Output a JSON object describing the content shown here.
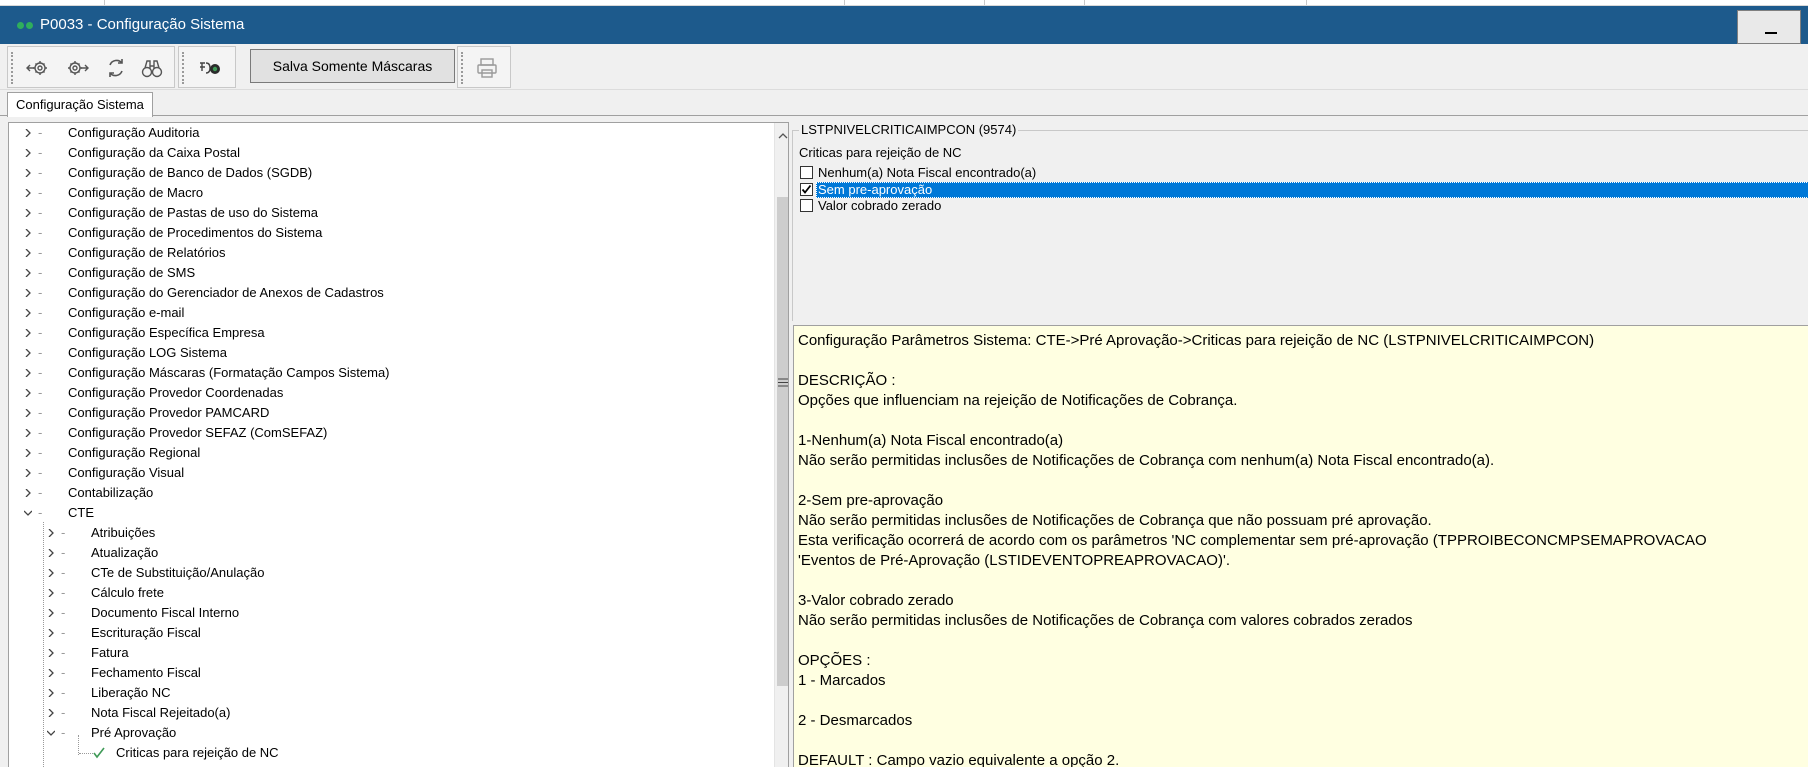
{
  "window": {
    "title": "P0033 - Configuração Sistema"
  },
  "toolbar": {
    "icons": [
      "gear-arrow-left-icon",
      "gear-arrow-right-icon",
      "refresh-icon",
      "binoculars-icon",
      "key-search-icon",
      "printer-icon"
    ],
    "save_masks_label": "Salva Somente Máscaras"
  },
  "tabs": [
    {
      "label": "Configuração Sistema",
      "active": true
    }
  ],
  "tree": {
    "items": [
      {
        "label": "Configuração Auditoria",
        "level": 0,
        "state": "collapsed"
      },
      {
        "label": "Configuração da Caixa Postal",
        "level": 0,
        "state": "collapsed"
      },
      {
        "label": "Configuração de Banco de Dados (SGDB)",
        "level": 0,
        "state": "collapsed"
      },
      {
        "label": "Configuração de Macro",
        "level": 0,
        "state": "collapsed"
      },
      {
        "label": "Configuração de Pastas de uso do Sistema",
        "level": 0,
        "state": "collapsed"
      },
      {
        "label": "Configuração de Procedimentos do Sistema",
        "level": 0,
        "state": "collapsed"
      },
      {
        "label": "Configuração de Relatórios",
        "level": 0,
        "state": "collapsed"
      },
      {
        "label": "Configuração de SMS",
        "level": 0,
        "state": "collapsed"
      },
      {
        "label": "Configuração do Gerenciador de Anexos de Cadastros",
        "level": 0,
        "state": "collapsed"
      },
      {
        "label": "Configuração e-mail",
        "level": 0,
        "state": "collapsed"
      },
      {
        "label": "Configuração Específica Empresa",
        "level": 0,
        "state": "collapsed"
      },
      {
        "label": "Configuração LOG Sistema",
        "level": 0,
        "state": "collapsed"
      },
      {
        "label": "Configuração Máscaras (Formatação Campos Sistema)",
        "level": 0,
        "state": "collapsed"
      },
      {
        "label": "Configuração Provedor Coordenadas",
        "level": 0,
        "state": "collapsed"
      },
      {
        "label": "Configuração Provedor PAMCARD",
        "level": 0,
        "state": "collapsed"
      },
      {
        "label": "Configuração Provedor SEFAZ (ComSEFAZ)",
        "level": 0,
        "state": "collapsed"
      },
      {
        "label": "Configuração Regional",
        "level": 0,
        "state": "collapsed"
      },
      {
        "label": "Configuração Visual",
        "level": 0,
        "state": "collapsed"
      },
      {
        "label": "Contabilização",
        "level": 0,
        "state": "collapsed"
      },
      {
        "label": "CTE",
        "level": 0,
        "state": "expanded"
      },
      {
        "label": "Atribuições",
        "level": 1,
        "state": "collapsed"
      },
      {
        "label": "Atualização",
        "level": 1,
        "state": "collapsed"
      },
      {
        "label": "CTe de Substituição/Anulação",
        "level": 1,
        "state": "collapsed"
      },
      {
        "label": "Cálculo frete",
        "level": 1,
        "state": "collapsed"
      },
      {
        "label": "Documento Fiscal Interno",
        "level": 1,
        "state": "collapsed"
      },
      {
        "label": "Escrituração Fiscal",
        "level": 1,
        "state": "collapsed"
      },
      {
        "label": "Fatura",
        "level": 1,
        "state": "collapsed"
      },
      {
        "label": "Fechamento Fiscal",
        "level": 1,
        "state": "collapsed"
      },
      {
        "label": "Liberação NC",
        "level": 1,
        "state": "collapsed"
      },
      {
        "label": "Nota Fiscal Rejeitado(a)",
        "level": 1,
        "state": "collapsed"
      },
      {
        "label": "Pré Aprovação",
        "level": 1,
        "state": "expanded"
      },
      {
        "label": "Criticas para rejeição de NC",
        "level": 2,
        "state": "leaf-checked"
      }
    ]
  },
  "parameter": {
    "legend": "LSTPNIVELCRITICAIMPCON (9574)",
    "caption": "Criticas para rejeição de NC",
    "options": [
      {
        "label": "Nenhum(a) Nota Fiscal encontrado(a)",
        "checked": false,
        "selected": false
      },
      {
        "label": "Sem pre-aprovação",
        "checked": true,
        "selected": true
      },
      {
        "label": "Valor cobrado zerado",
        "checked": false,
        "selected": false
      }
    ]
  },
  "description": {
    "lines": [
      "Configuração Parâmetros Sistema: CTE->Pré Aprovação->Criticas para rejeição de NC (LSTPNIVELCRITICAIMPCON)",
      "",
      "DESCRIÇÃO :",
      "Opções que influenciam na rejeição de Notificações de Cobrança.",
      "",
      "1-Nenhum(a) Nota Fiscal encontrado(a)",
      "Não serão permitidas inclusões de Notificações de Cobrança com nenhum(a) Nota Fiscal encontrado(a).",
      "",
      "2-Sem pre-aprovação",
      "Não serão permitidas inclusões de Notificações de Cobrança que não possuam pré aprovação.",
      "Esta verificação ocorrerá de acordo com os parâmetros 'NC complementar sem pré-aprovação (TPPROIBECONCMPSEMAPROVACAO",
      "'Eventos de Pré-Aprovação (LSTIDEVENTOPREAPROVACAO)'.",
      "",
      "3-Valor cobrado zerado",
      "Não serão permitidas inclusões de Notificações de Cobrança com valores cobrados zerados",
      "",
      "OPÇÕES :",
      "1 - Marcados",
      "",
      "2 - Desmarcados",
      "",
      "DEFAULT : Campo vazio equivalente a opção 2."
    ]
  },
  "colors": {
    "titlebar": "#1d5a8c",
    "selection": "#0078d7",
    "description_background": "#ffffe1",
    "check_icon": "#3f9a57"
  }
}
